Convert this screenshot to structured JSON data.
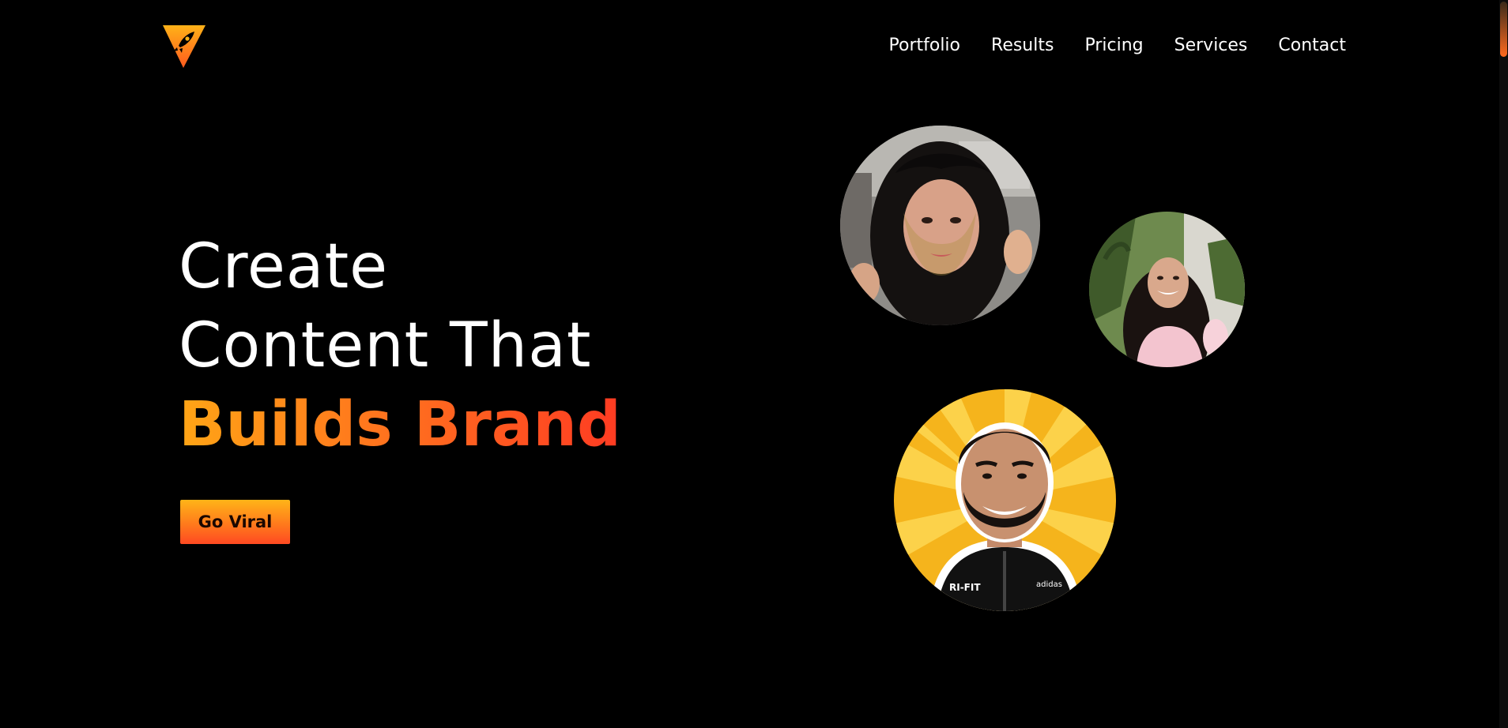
{
  "brand": {
    "logo_icon": "rocket-arrow-icon",
    "accent_colors": [
      "#ffa516",
      "#ff6a1f",
      "#ff3b22"
    ]
  },
  "nav": {
    "items": [
      {
        "label": "Portfolio"
      },
      {
        "label": "Results"
      },
      {
        "label": "Pricing"
      },
      {
        "label": "Services"
      },
      {
        "label": "Contact"
      }
    ]
  },
  "hero": {
    "line1": "Create",
    "line2": "Content That",
    "line3": "Builds Brand",
    "cta_label": "Go Viral"
  },
  "portraits": [
    {
      "name": "creator-portrait-woman-dark-hair"
    },
    {
      "name": "creator-portrait-woman-garden"
    },
    {
      "name": "creator-portrait-man-yellow-rays"
    }
  ]
}
